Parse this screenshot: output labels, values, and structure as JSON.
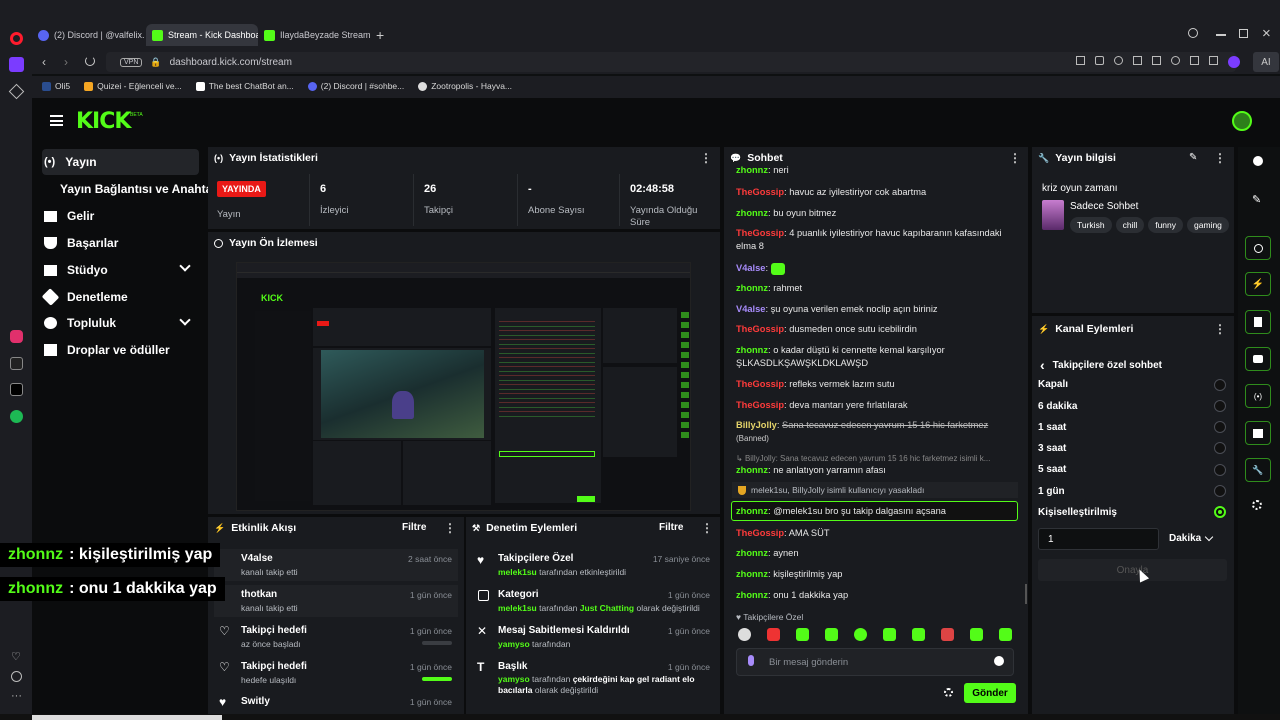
{
  "browser": {
    "tabs": [
      {
        "label": "(2) Discord | @valfelix."
      },
      {
        "label": "Stream - Kick Dashboard"
      },
      {
        "label": "IlaydaBeyzade Stream - W"
      }
    ],
    "vpn": "VPN",
    "url": "dashboard.kick.com/stream",
    "ai": "AI",
    "bookmarks": [
      {
        "label": "Oli5"
      },
      {
        "label": "Quizei - Eğlenceli ve..."
      },
      {
        "label": "The best ChatBot an..."
      },
      {
        "label": "(2) Discord | #sohbe..."
      },
      {
        "label": "Zootropolis - Hayva..."
      }
    ]
  },
  "logo": "KICK",
  "logo_beta": "BETA",
  "sidebar": {
    "items": [
      {
        "label": "Yayın",
        "icon": "broadcast-icon"
      },
      {
        "label": "Yayın Bağlantısı ve Anahtarı"
      },
      {
        "label": "Gelir",
        "icon": "bank-icon"
      },
      {
        "label": "Başarılar",
        "icon": "trophy-icon"
      },
      {
        "label": "Stüdyo",
        "icon": "studio-icon"
      },
      {
        "label": "Denetleme",
        "icon": "wrench-icon"
      },
      {
        "label": "Topluluk",
        "icon": "community-icon"
      },
      {
        "label": "Droplar ve ödüller",
        "icon": "gift-icon"
      }
    ]
  },
  "stats": {
    "title": "Yayın İstatistikleri",
    "live_badge": "YAYINDA",
    "live_label": "Yayın",
    "viewers_value": "6",
    "viewers_label": "İzleyici",
    "followers_value": "26",
    "followers_label": "Takipçi",
    "subs_value": "-",
    "subs_label": "Abone Sayısı",
    "uptime_value": "02:48:58",
    "uptime_label1": "Yayında Olduğu",
    "uptime_label2": "Süre"
  },
  "preview": {
    "title": "Yayın Ön İzlemesi"
  },
  "activity": {
    "title": "Etkinlik Akışı",
    "filter": "Filtre",
    "items": [
      {
        "name": "V4alse",
        "sub": "kanalı takip etti",
        "time": "2 saat önce"
      },
      {
        "name": "thotkan",
        "sub": "kanalı takip etti",
        "time": "1 gün önce"
      },
      {
        "name": "Takipçi hedefi",
        "sub": "az önce başladı",
        "time": "1 gün önce"
      },
      {
        "name": "Takipçi hedefi",
        "sub": "hedefe ulaşıldı",
        "time": "1 gün önce"
      },
      {
        "name": "Switly",
        "sub": "",
        "time": "1 gün önce"
      }
    ]
  },
  "moderation": {
    "title": "Denetim Eylemleri",
    "filter": "Filtre",
    "items": [
      {
        "name": "Takipçilere Özel",
        "actor": "melek1su",
        "rest": "tarafından etkinleştirildi",
        "time": "17 saniye önce"
      },
      {
        "name": "Kategori",
        "actor": "melek1su",
        "mid": "tarafından",
        "hl": "Just Chatting",
        "rest": "olarak değiştirildi",
        "time": "1 gün önce"
      },
      {
        "name": "Mesaj Sabitlemesi Kaldırıldı",
        "actor": "yamyso",
        "rest": "tarafından",
        "time": "1 gün önce"
      },
      {
        "name": "Başlık",
        "actor": "yamyso",
        "mid": "tarafından",
        "hl": "çekirdeğini kap gel radiant elo bacılarla",
        "rest": "olarak değiştirildi",
        "time": "1 gün önce"
      }
    ]
  },
  "chat": {
    "title": "Sohbet",
    "messages": [
      {
        "user": "zhonnz",
        "text": "neri"
      },
      {
        "user": "TheGossip",
        "text": "havuc az iyilestiriyor cok abartma"
      },
      {
        "user": "zhonnz",
        "text": "bu oyun bitmez"
      },
      {
        "user": "TheGossip",
        "text": "4 puanlık iyilestiriyor havuc kapıbaranın kafasındaki elma 8"
      },
      {
        "user": "V4alse",
        "text": ""
      },
      {
        "user": "zhonnz",
        "text": "rahmet"
      },
      {
        "user": "V4alse",
        "text": "şu oyuna verilen emek noclip açın biriniz"
      },
      {
        "user": "TheGossip",
        "text": "dusmeden once sutu icebilirdin"
      },
      {
        "user": "zhonnz",
        "text": "o kadar düştü ki cennette kemal karşılıyor ŞLKASDLKŞAWŞKLDKLAWŞD"
      },
      {
        "user": "TheGossip",
        "text": "refleks vermek lazım sutu"
      },
      {
        "user": "TheGossip",
        "text": "deva mantarı yere fırlatılarak"
      },
      {
        "user": "BillyJolly",
        "text": "Sana tecavuz edecen yavrum 15 16 hic farketmez",
        "banned": "(Banned)"
      },
      {
        "user": "",
        "text": "BillyJolly: Sana tecavuz edecen yavrum 15 16 hic farketmez isimli k..."
      },
      {
        "user": "zhonnz",
        "text": "ne anlatıyon yarramın afası"
      },
      {
        "user": "",
        "text": "melek1su, BillyJolly isimli kullanıcıyı yasakladı"
      },
      {
        "user": "zhonnz",
        "text": "@melek1su bro şu takip dalgasını açsana"
      },
      {
        "user": "TheGossip",
        "text": "AMA SÜT"
      },
      {
        "user": "zhonnz",
        "text": "aynen"
      },
      {
        "user": "zhonnz",
        "text": "kişileştirilmiş yap"
      },
      {
        "user": "zhonnz",
        "text": "onu 1 dakkika yap"
      }
    ],
    "mode_label": "Takipçilere Özel",
    "input_placeholder": "Bir mesaj gönderin",
    "send": "Gönder"
  },
  "stream_info": {
    "title": "Yayın bilgisi",
    "stream_title": "kriz oyun zamanı",
    "category": "Sadece Sohbet",
    "tags": [
      "Turkish",
      "chill",
      "funny",
      "gaming"
    ]
  },
  "channel_actions": {
    "title": "Kanal Eylemleri",
    "back_label": "Takipçilere özel sohbet",
    "options": [
      "Kapalı",
      "6 dakika",
      "1 saat",
      "3 saat",
      "5 saat",
      "1 gün",
      "Kişiselleştirilmiş"
    ],
    "selected": "Kişiselleştirilmiş",
    "custom_value": "1",
    "unit": "Dakika",
    "confirm": "Onayla"
  },
  "captions": [
    {
      "user": "zhonnz",
      "text": ": kişileştirilmiş yap"
    },
    {
      "user": "zhonnz",
      "text": ": onu 1 dakkika yap"
    }
  ],
  "colors": {
    "accent": "#53fc18",
    "live": "#e91916",
    "panel": "#191b1f",
    "bg": "#0b0c0d"
  }
}
